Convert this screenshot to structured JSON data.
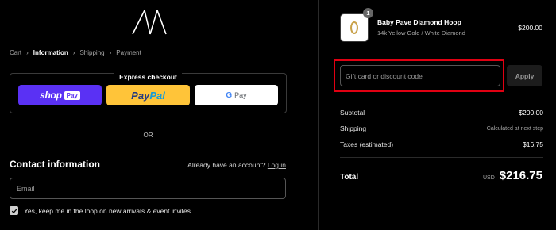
{
  "breadcrumb": {
    "items": [
      {
        "label": "Cart"
      },
      {
        "label": "Information"
      },
      {
        "label": "Shipping"
      },
      {
        "label": "Payment"
      }
    ]
  },
  "express": {
    "title": "Express checkout",
    "shop_pay": {
      "word": "shop",
      "badge": "Pay",
      "color": "#5a31f4"
    },
    "paypal": {
      "part1": "Pay",
      "part2": "Pal",
      "color": "#ffc439"
    },
    "gpay": {
      "g": "G",
      "label": "Pay"
    }
  },
  "or_text": "OR",
  "contact": {
    "title": "Contact information",
    "account_prompt": "Already have an account?",
    "login_label": "Log in",
    "email_placeholder": "Email",
    "newsletter_label": "Yes, keep me in the loop on new arrivals & event invites",
    "newsletter_checked": true
  },
  "cart": {
    "quantity": "1",
    "product_name": "Baby Pave Diamond Hoop",
    "product_variant": "14k Yellow Gold / White Diamond",
    "product_price": "$200.00"
  },
  "discount": {
    "placeholder": "Gift card or discount code",
    "apply_label": "Apply",
    "highlight_color": "#e00012"
  },
  "summary": {
    "subtotal_label": "Subtotal",
    "subtotal_value": "$200.00",
    "shipping_label": "Shipping",
    "shipping_value": "Calculated at next step",
    "taxes_label": "Taxes (estimated)",
    "taxes_value": "$16.75",
    "total_label": "Total",
    "total_currency": "USD",
    "total_value": "$216.75"
  }
}
